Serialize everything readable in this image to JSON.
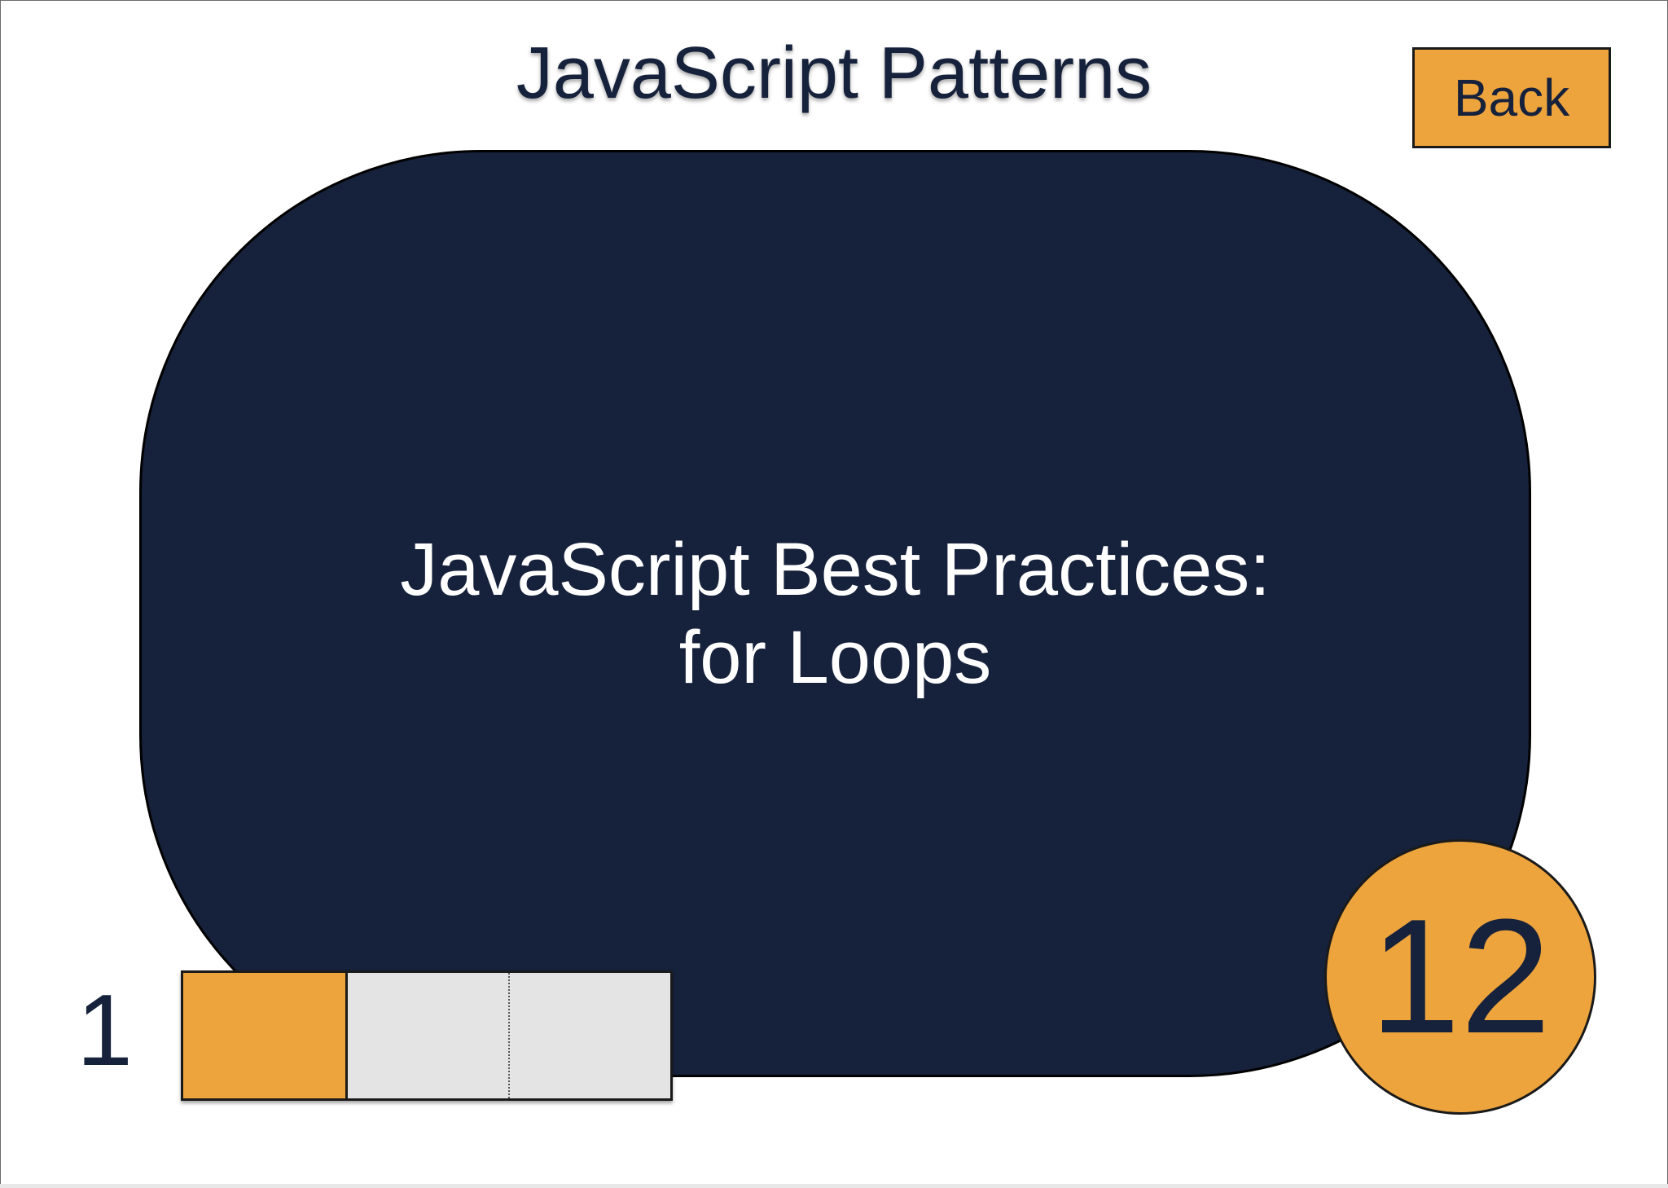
{
  "header": {
    "title": "JavaScript Patterns",
    "back_label": "Back"
  },
  "card": {
    "line1": "JavaScript Best Practices:",
    "line2": "for Loops"
  },
  "counter": {
    "value": "12"
  },
  "progress": {
    "label": "1",
    "fill_fraction": 0.333,
    "segments": 3
  },
  "colors": {
    "accent": "#eea43d",
    "navy": "#16213b",
    "track": "#e4e4e4"
  }
}
